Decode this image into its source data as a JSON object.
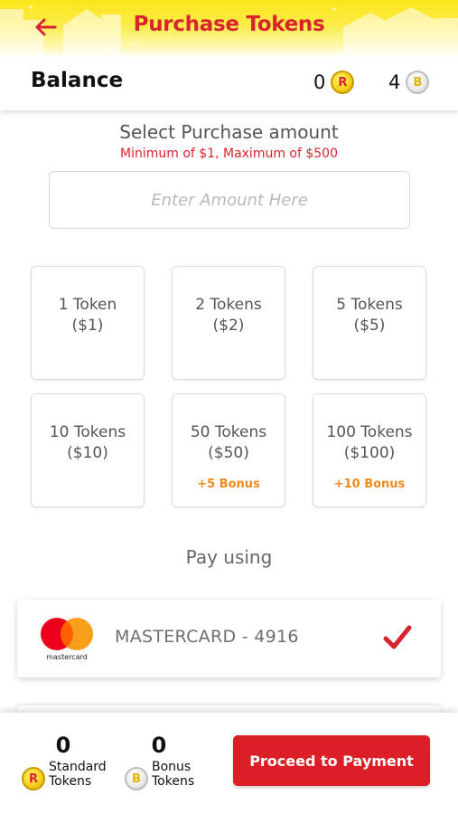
{
  "header": {
    "title": "Purchase Tokens",
    "back_icon": "arrow-left-icon",
    "accent_color": "#d9232d",
    "background_color": "#fbe61a"
  },
  "balance": {
    "label": "Balance",
    "standard_count": "0",
    "bonus_count": "4",
    "standard_coin_letter": "R",
    "bonus_coin_letter": "B"
  },
  "purchase": {
    "title": "Select Purchase amount",
    "subtitle": "Minimum of $1, Maximum of $500",
    "amount_placeholder": "Enter Amount Here",
    "amount_value": ""
  },
  "options": [
    {
      "name": "1 Token",
      "price": "($1)",
      "bonus": ""
    },
    {
      "name": "2 Tokens",
      "price": "($2)",
      "bonus": ""
    },
    {
      "name": "5 Tokens",
      "price": "($5)",
      "bonus": ""
    },
    {
      "name": "10 Tokens",
      "price": "($10)",
      "bonus": ""
    },
    {
      "name": "50 Tokens",
      "price": "($50)",
      "bonus": "+5 Bonus"
    },
    {
      "name": "100 Tokens",
      "price": "($100)",
      "bonus": "+10 Bonus"
    }
  ],
  "payment": {
    "heading": "Pay using",
    "method_label": "MASTERCARD - 4916",
    "brand_text": "mastercard",
    "selected": true,
    "check_icon": "checkmark-icon"
  },
  "footer": {
    "standard_count": "0",
    "standard_label_line1": "Standard",
    "standard_label_line2": "Tokens",
    "bonus_count": "0",
    "bonus_label_line1": "Bonus",
    "bonus_label_line2": "Tokens",
    "proceed_label": "Proceed to Payment",
    "button_color": "#dc1f26"
  }
}
